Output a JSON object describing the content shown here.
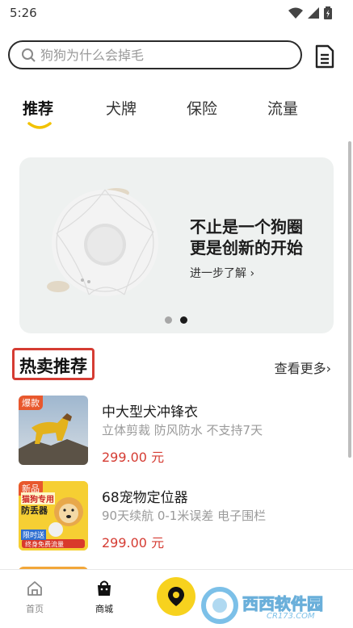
{
  "status_bar": {
    "time": "5:26"
  },
  "search": {
    "placeholder": "狗狗为什么会掉毛"
  },
  "tabs": [
    {
      "label": "推荐",
      "active": true
    },
    {
      "label": "犬牌",
      "active": false
    },
    {
      "label": "保险",
      "active": false
    },
    {
      "label": "流量",
      "active": false
    }
  ],
  "banner": {
    "headline_line1": "不止是一个狗圈",
    "headline_line2": "更是创新的开始",
    "more_label": "进一步了解 ›",
    "page_count": 2,
    "current_page": 2
  },
  "section": {
    "title": "热卖推荐",
    "see_more": "查看更多›"
  },
  "products": [
    {
      "badge": "爆款",
      "name": "中大型犬冲锋衣",
      "desc": "立体剪裁 防风防水 不支持7天",
      "price": "299.00 元"
    },
    {
      "badge": "新品",
      "name": "68宠物定位器",
      "desc": "90天续航 0-1米误差 电子围栏",
      "price": "299.00 元"
    }
  ],
  "thumb2_text": {
    "line1": "猫狗专用",
    "line2": "防丢器",
    "line3": "限时送",
    "line4": "终身免费流量"
  },
  "bottom_nav": [
    {
      "label": "首页",
      "active": false
    },
    {
      "label": "商城",
      "active": true
    }
  ],
  "watermark": {
    "text": "西西软件园",
    "sub": "CR173.COM"
  },
  "colors": {
    "accent": "#f7d21e",
    "price": "#d53c33",
    "banner_bg": "#eef1f0"
  }
}
